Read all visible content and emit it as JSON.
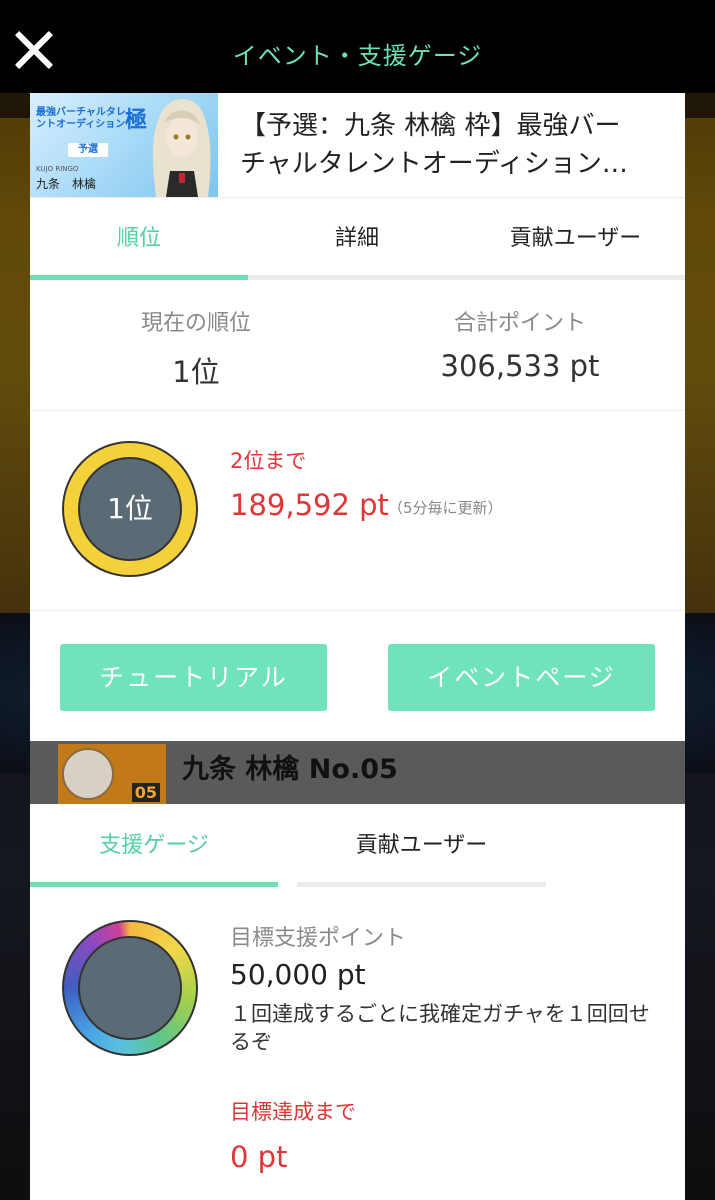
{
  "header": {
    "title": "イベント・支援ゲージ"
  },
  "event": {
    "banner": {
      "logo_text": "最強バーチャルタレントオーディション",
      "kanji": "極",
      "stage": "予選",
      "romaji": "KUJO RINGO",
      "name": "九条　林檎"
    },
    "title_line1": "【予選：九条 林檎 枠】最強バー",
    "title_line2": "チャルタレントオーディション…"
  },
  "ranking_tabs": [
    {
      "label": "順位",
      "active": true
    },
    {
      "label": "詳細",
      "active": false
    },
    {
      "label": "貢献ユーザー",
      "active": false
    }
  ],
  "stats": {
    "rank_label": "現在の順位",
    "rank_value": "1位",
    "points_label": "合計ポイント",
    "points_value": "306,533 pt"
  },
  "rank_badge": {
    "text": "1位"
  },
  "next_rank": {
    "label": "2位まで",
    "value": "189,592 pt",
    "note": "（5分毎に更新）"
  },
  "buttons": {
    "tutorial": "チュートリアル",
    "event_page": "イベントページ"
  },
  "talent": {
    "name": "九条 林檎 No.05",
    "number": "05"
  },
  "support_tabs": [
    {
      "label": "支援ゲージ",
      "active": true
    },
    {
      "label": "貢献ユーザー",
      "active": false
    }
  ],
  "support": {
    "target_label": "目標支援ポイント",
    "target_value": "50,000 pt",
    "description": "１回達成するごとに我確定ガチャを１回回せるぞ",
    "remain_label": "目標達成まで",
    "remain_value": "0 pt"
  },
  "colors": {
    "accent": "#6fdfb6",
    "alert": "#e03636",
    "rank_ring": "#f4d13b",
    "ring_inner": "#5b6b76"
  }
}
